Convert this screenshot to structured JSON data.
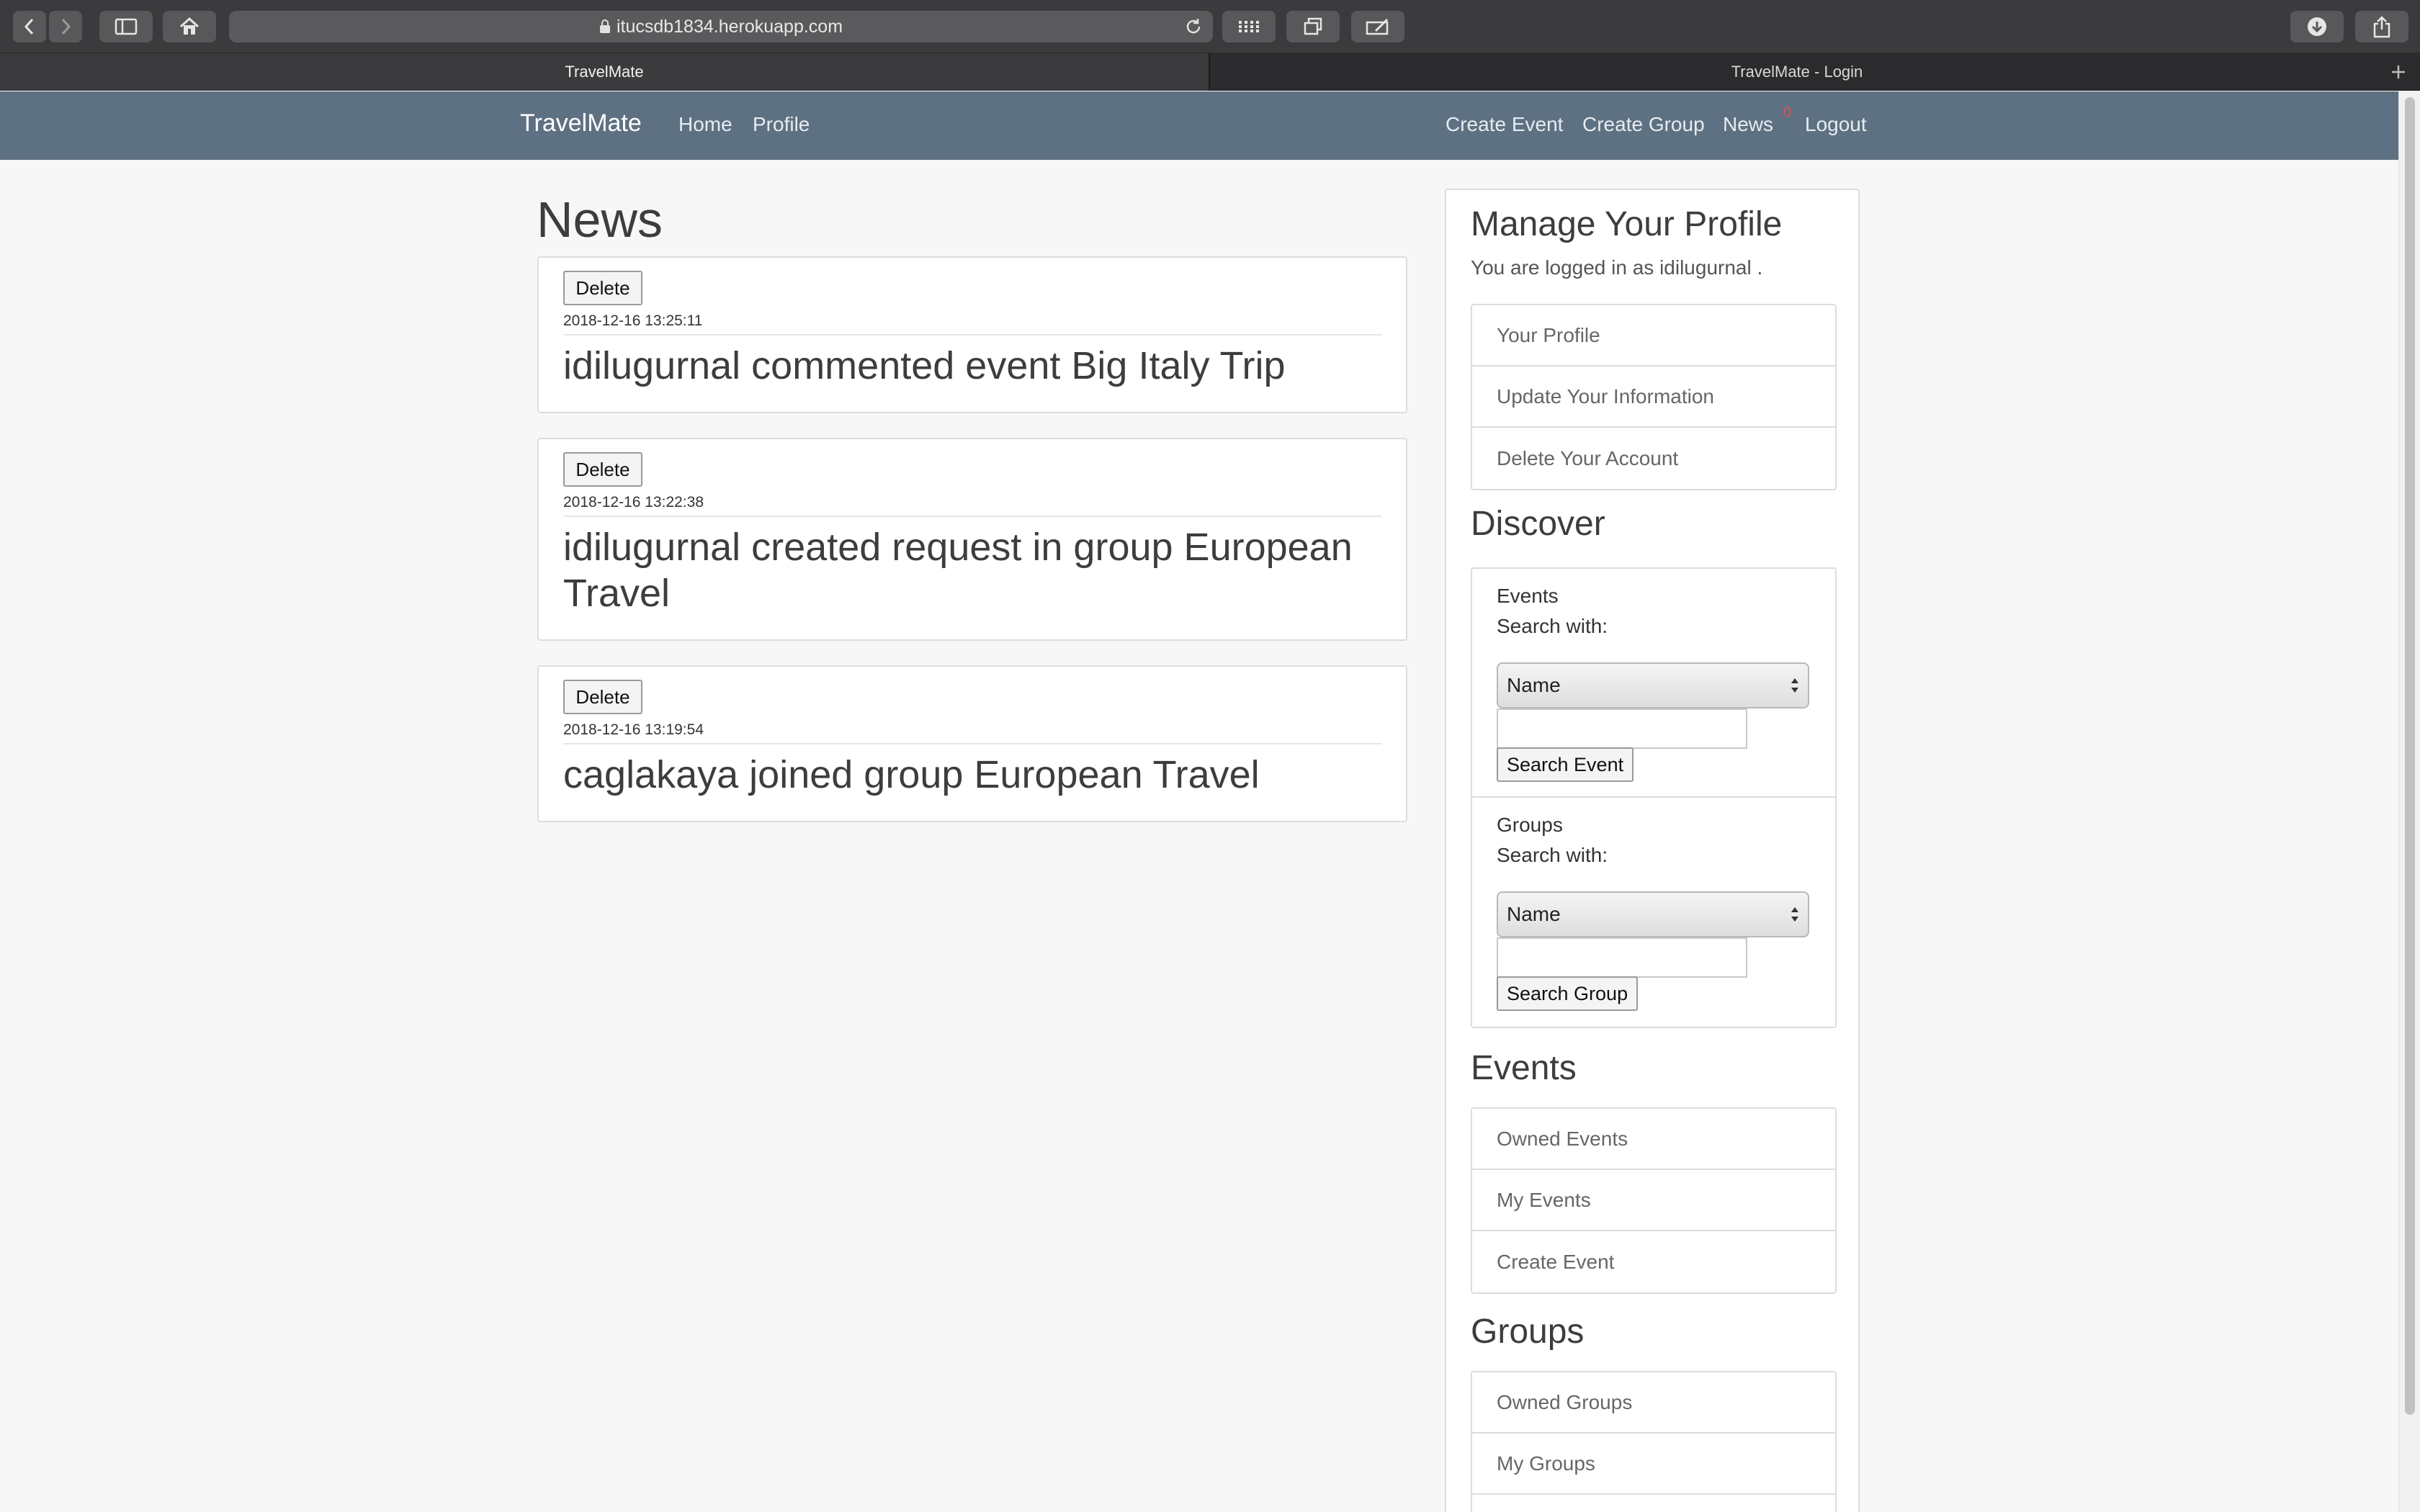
{
  "browser": {
    "url": "itucsdb1834.herokuapp.com",
    "tabs": [
      {
        "title": "TravelMate",
        "active": true
      },
      {
        "title": "TravelMate - Login",
        "active": false
      }
    ]
  },
  "navbar": {
    "brand": "TravelMate",
    "left_links": [
      "Home",
      "Profile"
    ],
    "right_links": [
      "Create Event",
      "Create Group",
      "News",
      "Logout"
    ],
    "news_badge": "0",
    "background_color": "#5e7182"
  },
  "news": {
    "heading": "News",
    "items": [
      {
        "delete_label": "Delete",
        "timestamp": "2018-12-16 13:25:11",
        "text": "idilugurnal commented event Big Italy Trip"
      },
      {
        "delete_label": "Delete",
        "timestamp": "2018-12-16 13:22:38",
        "text": "idilugurnal created request in group European Travel"
      },
      {
        "delete_label": "Delete",
        "timestamp": "2018-12-16 13:19:54",
        "text": "caglakaya joined group European Travel"
      }
    ]
  },
  "sidebar": {
    "profile_heading": "Manage Your Profile",
    "logged_in_text": "You are logged in as idilugurnal .",
    "profile_links": [
      "Your Profile",
      "Update Your Information",
      "Delete Your Account"
    ],
    "discover_heading": "Discover",
    "discover": {
      "events": {
        "label": "Events",
        "search_with": "Search with:",
        "selected": "Name",
        "input_value": "",
        "button": "Search Event"
      },
      "groups": {
        "label": "Groups",
        "search_with": "Search with:",
        "selected": "Name",
        "input_value": "",
        "button": "Search Group"
      }
    },
    "events_heading": "Events",
    "event_links": [
      "Owned Events",
      "My Events",
      "Create Event"
    ],
    "groups_heading": "Groups",
    "group_links": [
      "Owned Groups",
      "My Groups",
      ""
    ]
  }
}
